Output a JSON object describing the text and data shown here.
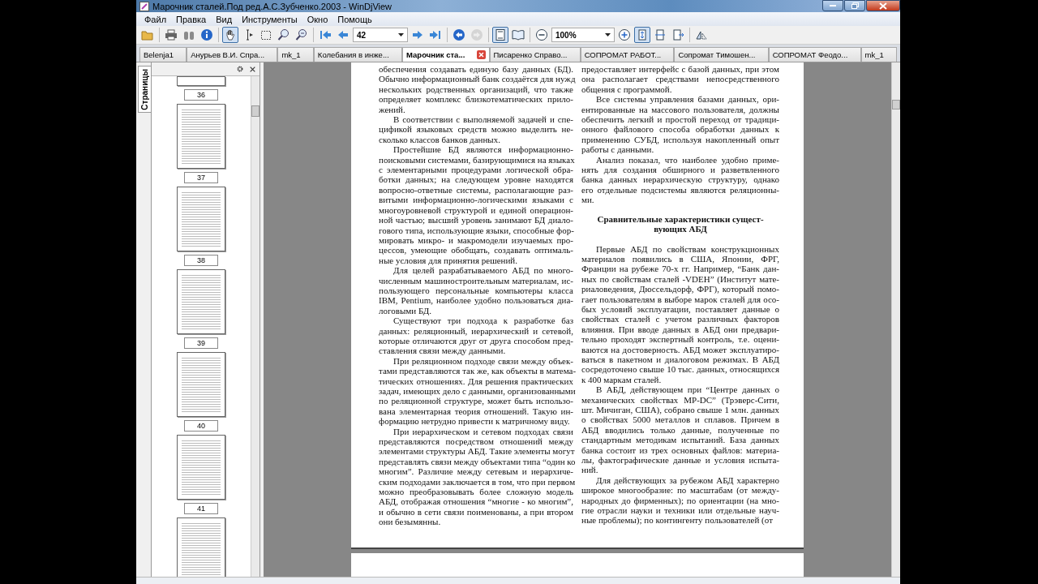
{
  "window": {
    "title": "Марочник сталей.Под ред.А.С.Зубченко.2003 - WinDjView"
  },
  "menu": [
    "Файл",
    "Правка",
    "Вид",
    "Инструменты",
    "Окно",
    "Помощь"
  ],
  "toolbar": {
    "groups": [
      [
        {
          "kind": "button",
          "pressed": false,
          "disabled": false
        }
      ],
      [
        {
          "kind": "button",
          "pressed": false,
          "disabled": false
        },
        {
          "kind": "button",
          "pressed": false,
          "disabled": false
        },
        {
          "kind": "button",
          "pressed": false,
          "disabled": false
        }
      ],
      [
        {
          "kind": "button",
          "pressed": true,
          "disabled": false
        },
        {
          "kind": "button",
          "pressed": false,
          "disabled": false
        },
        {
          "kind": "button",
          "pressed": false,
          "disabled": false
        },
        {
          "kind": "button",
          "pressed": false,
          "disabled": false
        },
        {
          "kind": "button",
          "pressed": false,
          "disabled": false
        }
      ],
      [
        {
          "kind": "button",
          "pressed": false,
          "disabled": false
        },
        {
          "kind": "button",
          "pressed": false,
          "disabled": false
        },
        {
          "kind": "combo",
          "value": "42"
        },
        {
          "kind": "button",
          "pressed": false,
          "disabled": false
        },
        {
          "kind": "button",
          "pressed": false,
          "disabled": false
        }
      ],
      [
        {
          "kind": "button",
          "pressed": false,
          "disabled": false
        },
        {
          "kind": "button",
          "pressed": false,
          "disabled": true
        }
      ],
      [
        {
          "kind": "button",
          "pressed": true,
          "disabled": false
        },
        {
          "kind": "button",
          "pressed": false,
          "disabled": false
        }
      ],
      [
        {
          "kind": "button",
          "pressed": false,
          "disabled": false
        },
        {
          "kind": "combo",
          "value": "100%"
        },
        {
          "kind": "button",
          "pressed": false,
          "disabled": false
        },
        {
          "kind": "button",
          "pressed": true,
          "disabled": false
        },
        {
          "kind": "button",
          "pressed": false,
          "disabled": false
        },
        {
          "kind": "button",
          "pressed": false,
          "disabled": false
        }
      ],
      [
        {
          "kind": "button",
          "pressed": false,
          "disabled": false
        }
      ]
    ]
  },
  "tabs": [
    {
      "label": "Belenja1",
      "selected": false
    },
    {
      "label": "Анурьев В.И. Спра...",
      "selected": false
    },
    {
      "label": "mk_1",
      "selected": false
    },
    {
      "label": "Колебания в инже...",
      "selected": false
    },
    {
      "label": "Марочник ста...",
      "selected": true
    },
    {
      "label": "Писаренко Справо...",
      "selected": false
    },
    {
      "label": "СОПРОМАТ РАБОТ...",
      "selected": false
    },
    {
      "label": "Сопромат Тимошен...",
      "selected": false
    },
    {
      "label": "СОПРОМАТ Феодо...",
      "selected": false
    },
    {
      "label": "mk_1",
      "selected": false
    }
  ],
  "sidebar": {
    "tab": "Страницы",
    "thumbnails": [
      {
        "label": "36"
      },
      {
        "label": "37"
      },
      {
        "label": "38"
      },
      {
        "label": "39"
      },
      {
        "label": "40"
      },
      {
        "label": "41"
      }
    ]
  },
  "page": {
    "columns": [
      {
        "blocks": [
          {
            "kind": "paragraph",
            "indent": false,
            "lines": [
              "обеспечения создавать единую базу данных (БД).",
              "Обычно информационный банк создаётся для нужд",
              "нескольких родственных организаций, что также",
              "определяет комплекс близкотематических прило-",
              "жений."
            ]
          },
          {
            "kind": "paragraph",
            "indent": true,
            "lines": [
              "В соответствии с выполняемой задачей и спе-",
              "цификой языковых средств можно выделить не-",
              "сколько классов банков данных."
            ]
          },
          {
            "kind": "paragraph",
            "indent": true,
            "lines": [
              "Простейшие БД являются информационно-",
              "поисковыми системами, базирующимися на языках",
              "с элементарными процедурами логической обра-",
              "ботки данных; на следующем уровне находятся",
              "вопросно-ответные системы, располагающие раз-",
              "витыми информационно-логическими языками с",
              "многоуровневой структурой и единой операцион-",
              "ной частью; высший уровень занимают БД диало-",
              "гового типа, использующие языки, способные фор-",
              "мировать микро- и макромодели изучаемых про-",
              "цессов, умеющие обобщать, создавать оптималь-",
              "ные условия для принятия решений."
            ]
          },
          {
            "kind": "paragraph",
            "indent": true,
            "lines": [
              "Для целей разрабатываемого АБД по много-",
              "численным машиностроительным материалам, ис-",
              "пользующего персональные компьютеры класса",
              "IBM, Pentium, наиболее удобно пользоваться диа-",
              "логовыми БД."
            ]
          },
          {
            "kind": "paragraph",
            "indent": true,
            "lines": [
              "Существуют три подхода к разработке баз",
              "данных: реляционный, иерархический и сетевой,",
              "которые отличаются друг от друга способом пред-",
              "ставления связи между данными."
            ]
          },
          {
            "kind": "paragraph",
            "indent": true,
            "lines": [
              "При реляционном подходе связи между объек-",
              "тами представляются так же, как объекты в матема-",
              "тических отношениях. Для решения практических",
              "задач, имеющих дело с данными, организованными",
              "по реляционной структуре, может быть использо-",
              "вана элементарная теория отношений. Такую ин-",
              "формацию нетрудно привести к матричному виду."
            ]
          },
          {
            "kind": "paragraph",
            "indent": true,
            "lines": [
              "При иерархическом и сетевом подходах связи",
              "представляются посредством отношений между",
              "элементами структуры АБД. Такие элементы могут",
              "представлять связи между объектами типа “один ко",
              "многим”. Различие между сетевым и иерархиче-",
              "ским подходами заключается в том, что при первом",
              "можно преобразовывать более сложную модель",
              "АБД, отображая отношения “многие - ко многим”,",
              "и обычно в сети связи поименованы, а при втором",
              "они безымянны."
            ]
          }
        ]
      },
      {
        "blocks": [
          {
            "kind": "paragraph",
            "indent": false,
            "lines": [
              "предоставляет интерфейс с базой данных, при этом",
              "она располагает средствами непосредственного",
              "общения с программой."
            ]
          },
          {
            "kind": "paragraph",
            "indent": true,
            "lines": [
              "Все системы управления базами данных, ори-",
              "ентированные на массового пользователя, должны",
              "обеспечить легкий и простой переход от традици-",
              "онного файлового способа обработки данных к",
              "применению СУБД, используя накопленный опыт",
              "работы с данными."
            ]
          },
          {
            "kind": "paragraph",
            "indent": true,
            "lines": [
              "Анализ показал, что наиболее удобно приме-",
              "нять для создания обширного и разветвленного",
              "банка данных иерархическую структуру, однако",
              "его отдельные подсистемы являются реляционны-",
              "ми."
            ]
          },
          {
            "kind": "heading",
            "lines": [
              "Сравнительные характеристики сущест-",
              "вующих АБД"
            ]
          },
          {
            "kind": "paragraph",
            "indent": true,
            "lines": [
              "Первые АБД по свойствам конструкционных",
              "материалов появились в США, Японии, ФРГ,",
              "Франции на рубеже 70-х гг. Например, “Банк дан-",
              "ных по свойствам сталей -VDEH” (Институт мате-",
              "риаловедения, Дюссельдорф, ФРГ), который помо-",
              "гает пользователям в выборе марок сталей для осо-",
              "бых условий эксплуатации, поставляет данные о",
              "свойствах сталей с учетом различных факторов",
              "влияния. При вводе данных в АБД они предвари-",
              "тельно проходят экспертный контроль, т.е. оцени-",
              "ваются на достоверность. АБД может эксплуатиро-",
              "ваться в пакетном и диалоговом режимах. В АБД",
              "сосредоточено свыше 10 тыс. данных, относящихся",
              "к 400 маркам сталей."
            ]
          },
          {
            "kind": "paragraph",
            "indent": true,
            "lines": [
              "В АБД, действующем при “Центре данных о",
              "механических свойствах MP-DC” (Трэверс-Сити,",
              "шт. Мичиган, США), собрано свыше 1 млн. данных",
              "о свойствах 5000 металлов и сплавов. Причем в",
              "АБД вводились только данные, полученные по",
              "стандартным методикам испытаний. База данных",
              "банка состоит из трех основных файлов: материа-",
              "лы, фактографические данные и условия испыта-",
              "ний."
            ]
          },
          {
            "kind": "paragraph",
            "indent": true,
            "lines": [
              "Для действующих за рубежом АБД характерно",
              "широкое многообразие: по масштабам (от между-",
              "народных до фирменных); по ориентации (на мно-",
              "гие отрасли науки и техники или отдельные науч-",
              "ные проблемы); по контингенту пользователей (от"
            ]
          }
        ]
      }
    ]
  }
}
